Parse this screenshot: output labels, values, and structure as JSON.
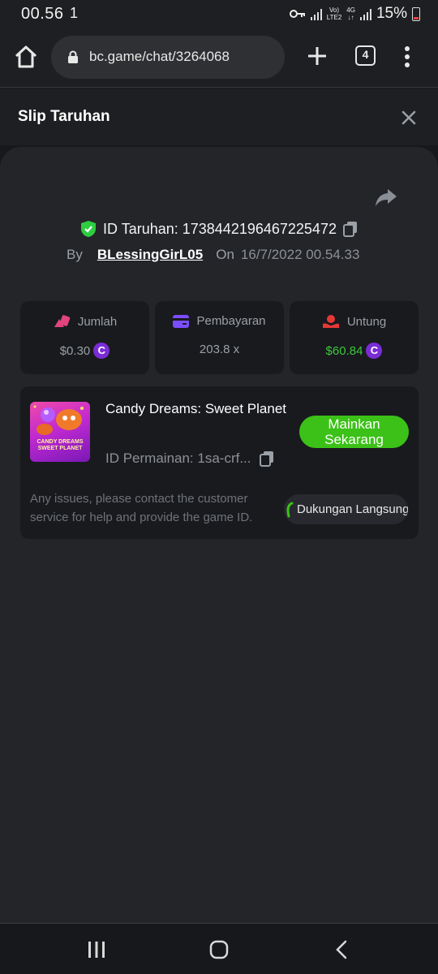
{
  "status_bar": {
    "time": "00.56",
    "extra": "1",
    "volte_label_top": "Vo)",
    "volte_label_bottom": "LTE2",
    "network_top": "4G",
    "network_bottom": "↓↑",
    "battery": "15%"
  },
  "browser": {
    "url": "bc.game/chat/3264068",
    "tab_count": "4"
  },
  "slip": {
    "title": "Slip Taruhan",
    "bet_id": "ID Taruhan: 1738442196467225472",
    "by_label": "By",
    "username": "BLessingGirL05",
    "on_label": "On",
    "date": "16/7/2022 00.54.33",
    "stats": [
      {
        "label": "Jumlah",
        "value": "$0.30",
        "icon": "bet-amount-icon",
        "coin": "C"
      },
      {
        "label": "Pembayaran",
        "value": "203.8 x",
        "icon": "payment-card-icon"
      },
      {
        "label": "Untung",
        "value": "$60.84",
        "icon": "profit-icon",
        "coin": "C"
      }
    ],
    "game": {
      "thumb_text": "CANDY DREAMS SWEET PLANET",
      "title": "Candy Dreams: Sweet Planet",
      "game_id": "ID Permainan: 1sa-crf...",
      "play_label": "Mainkan Sekarang",
      "issue_text": "Any issues, please contact the customer service for help and provide the game ID.",
      "support_label": "Dukungan Langsung"
    }
  },
  "colors": {
    "accent_green": "#3bc117",
    "profit_green": "#3cc83c",
    "coin_purple": "#7a2dd6",
    "shield_green": "#2ecc40",
    "payment_purple": "#7b4dff",
    "profit_red": "#e53935",
    "bet_pink": "#e0457b"
  }
}
